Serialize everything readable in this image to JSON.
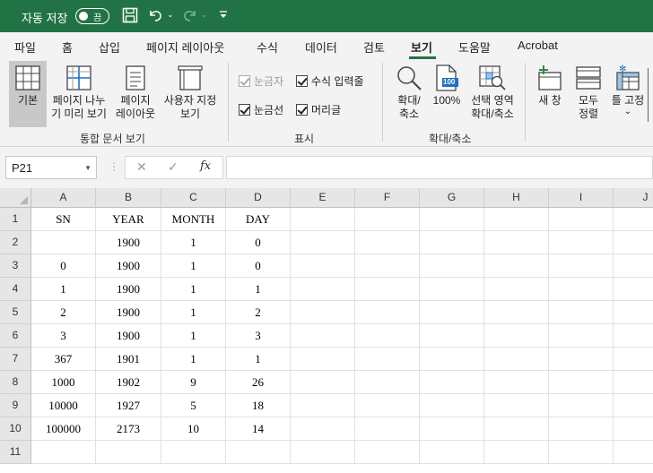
{
  "titlebar": {
    "autosave_label": "자동 저장",
    "autosave_state": "끔"
  },
  "tabs": [
    "파일",
    "홈",
    "삽입",
    "페이지 레이아웃",
    "수식",
    "데이터",
    "검토",
    "보기",
    "도움말",
    "Acrobat"
  ],
  "active_tab": "보기",
  "ribbon": {
    "buttons": {
      "normal": "기본",
      "page_break_1": "페이지 나누",
      "page_break_2": "기 미리 보기",
      "page_layout_1": "페이지",
      "page_layout_2": "레이아웃",
      "custom_view_1": "사용자 지정",
      "custom_view_2": "보기",
      "zoom_1": "확대/",
      "zoom_2": "축소",
      "zoom100": "100%",
      "zoom100_icon_text": "100",
      "zoom_sel_1": "선택 영역",
      "zoom_sel_2": "확대/축소",
      "new_window_1": "새 창",
      "arrange_1": "모두",
      "arrange_2": "정렬",
      "freeze_1": "틀 고정",
      "freeze_caret": "⌄"
    },
    "checks": {
      "ruler": "눈금자",
      "formula_bar": "수식 입력줄",
      "gridlines": "눈금선",
      "headings": "머리글"
    },
    "groups": {
      "workbook_views": "통합 문서 보기",
      "show": "표시",
      "zoom": "확대/축소"
    }
  },
  "formula_bar": {
    "name_box": "P21",
    "fx": "fx",
    "formula": ""
  },
  "grid": {
    "columns": [
      "A",
      "B",
      "C",
      "D",
      "E",
      "F",
      "G",
      "H",
      "I",
      "J"
    ],
    "rows": [
      {
        "num": "1",
        "cells": [
          "SN",
          "YEAR",
          "MONTH",
          "DAY"
        ]
      },
      {
        "num": "2",
        "cells": [
          "",
          "1900",
          "1",
          "0"
        ]
      },
      {
        "num": "3",
        "cells": [
          "0",
          "1900",
          "1",
          "0"
        ]
      },
      {
        "num": "4",
        "cells": [
          "1",
          "1900",
          "1",
          "1"
        ]
      },
      {
        "num": "5",
        "cells": [
          "2",
          "1900",
          "1",
          "2"
        ]
      },
      {
        "num": "6",
        "cells": [
          "3",
          "1900",
          "1",
          "3"
        ]
      },
      {
        "num": "7",
        "cells": [
          "367",
          "1901",
          "1",
          "1"
        ]
      },
      {
        "num": "8",
        "cells": [
          "1000",
          "1902",
          "9",
          "26"
        ]
      },
      {
        "num": "9",
        "cells": [
          "10000",
          "1927",
          "5",
          "18"
        ]
      },
      {
        "num": "10",
        "cells": [
          "100000",
          "2173",
          "10",
          "14"
        ]
      },
      {
        "num": "11",
        "cells": [
          "",
          "",
          "",
          ""
        ]
      }
    ]
  },
  "colors": {
    "titlebar": "#217346",
    "accent": "#217346",
    "zoom100_blue": "#1e6fc6"
  }
}
